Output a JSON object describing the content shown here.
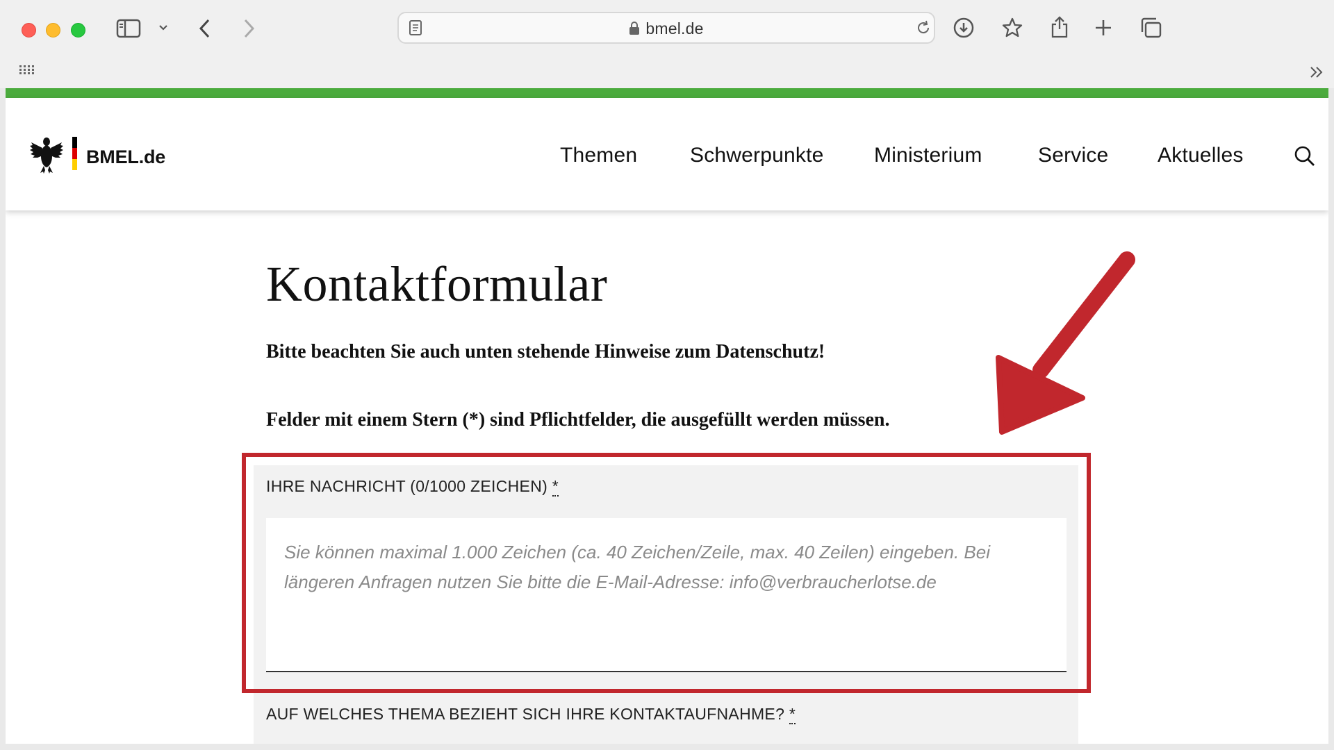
{
  "browser": {
    "url": "bmel.de",
    "icons": [
      "sidebar-icon",
      "chevron-down-icon",
      "back-icon",
      "forward-icon",
      "reader-icon",
      "lock-icon",
      "reload-icon",
      "download-icon",
      "star-icon",
      "share-icon",
      "plus-icon",
      "tabs-icon",
      "grid-icon",
      "double-chevron-icon"
    ]
  },
  "site": {
    "brand": "BMEL.de",
    "accent_green": "#4bab3d",
    "nav": [
      "Themen",
      "Schwerpunkte",
      "Ministerium",
      "Service",
      "Aktuelles"
    ]
  },
  "page": {
    "title": "Kontaktformular",
    "notice": "Bitte beachten Sie auch unten stehende Hinweise zum Datenschutz!",
    "required_note": "Felder mit einem Stern (*) sind Pflichtfelder, die ausgefüllt werden müssen.",
    "message_label": "IHRE NACHRICHT (0/1000 ZEICHEN)",
    "required_mark": "*",
    "message_placeholder": "Sie können maximal 1.000 Zeichen (ca. 40 Zeichen/Zeile, max. 40 Zeilen) eingeben. Bei längeren Anfragen nutzen Sie bitte die E-Mail-Adresse: info@verbraucherlotse.de",
    "topic_label": "AUF WELCHES THEMA BEZIEHT SICH IHRE KONTAKTAUFNAHME?"
  },
  "annotation": {
    "color": "#c1272d"
  }
}
